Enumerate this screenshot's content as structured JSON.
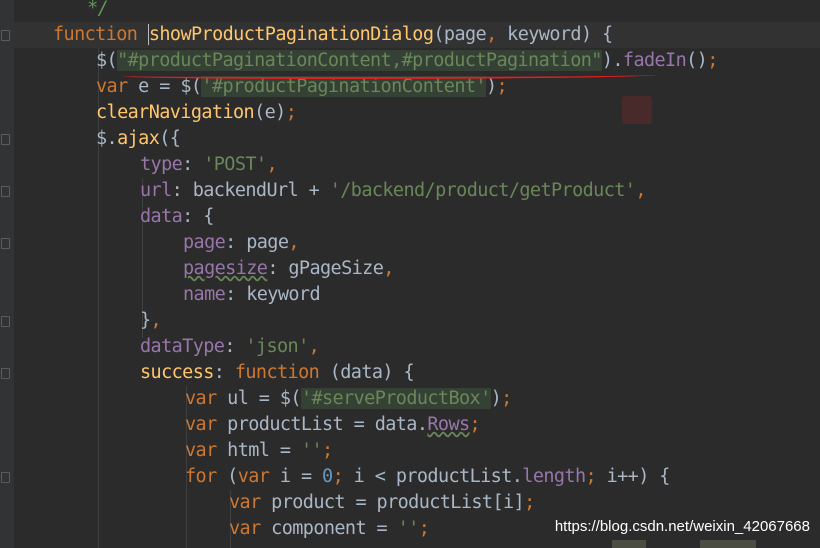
{
  "lines": [
    {
      "tokens": [
        {
          "t": "  */",
          "c": "cm"
        }
      ]
    },
    {
      "tokens": [
        {
          "t": "function",
          "c": "kw"
        },
        {
          "t": " "
        },
        {
          "t": "",
          "c": "caret"
        },
        {
          "t": "showProductPaginationDialog",
          "c": "fn"
        },
        {
          "t": "(page"
        },
        {
          "t": ",",
          "c": "kw"
        },
        {
          "t": " keyword) {"
        }
      ]
    },
    {
      "tokens": [
        {
          "t": "$("
        },
        {
          "t": "\"#productPaginationContent,#productPagination\"",
          "c": "sth"
        },
        {
          "t": ")."
        },
        {
          "t": "fadeIn",
          "c": "pr"
        },
        {
          "t": "()"
        },
        {
          "t": ";",
          "c": "kw"
        }
      ]
    },
    {
      "tokens": [
        {
          "t": "var",
          "c": "kw"
        },
        {
          "t": " e = $("
        },
        {
          "t": "'#productPaginationContent'",
          "c": "sth"
        },
        {
          "t": ")"
        },
        {
          "t": ";",
          "c": "kw"
        }
      ]
    },
    {
      "tokens": [
        {
          "t": "clearNavigation",
          "c": "fn"
        },
        {
          "t": "(e)"
        },
        {
          "t": ";",
          "c": "kw"
        }
      ]
    },
    {
      "tokens": [
        {
          "t": "$."
        },
        {
          "t": "ajax",
          "c": "fn"
        },
        {
          "t": "({"
        }
      ]
    },
    {
      "tokens": [
        {
          "t": "type",
          "c": "pr"
        },
        {
          "t": ": "
        },
        {
          "t": "'POST'",
          "c": "st"
        },
        {
          "t": ",",
          "c": "kw"
        }
      ]
    },
    {
      "tokens": [
        {
          "t": "url",
          "c": "pr"
        },
        {
          "t": ": backendUrl + "
        },
        {
          "t": "'/backend/product/getProduct'",
          "c": "st"
        },
        {
          "t": ",",
          "c": "kw"
        }
      ]
    },
    {
      "tokens": [
        {
          "t": "data",
          "c": "pr"
        },
        {
          "t": ": {"
        }
      ]
    },
    {
      "tokens": [
        {
          "t": "page",
          "c": "pr"
        },
        {
          "t": ": page"
        },
        {
          "t": ",",
          "c": "kw"
        }
      ]
    },
    {
      "tokens": [
        {
          "t": "pagesize",
          "c": "pr wavy"
        },
        {
          "t": ": gPageSize"
        },
        {
          "t": ",",
          "c": "kw"
        }
      ]
    },
    {
      "tokens": [
        {
          "t": "name",
          "c": "pr"
        },
        {
          "t": ": keyword"
        }
      ]
    },
    {
      "tokens": [
        {
          "t": "}"
        },
        {
          "t": ",",
          "c": "kw"
        }
      ]
    },
    {
      "tokens": [
        {
          "t": "dataType",
          "c": "pr"
        },
        {
          "t": ": "
        },
        {
          "t": "'json'",
          "c": "st"
        },
        {
          "t": ",",
          "c": "kw"
        }
      ]
    },
    {
      "tokens": [
        {
          "t": "success",
          "c": "fn"
        },
        {
          "t": ": "
        },
        {
          "t": "function",
          "c": "kw"
        },
        {
          "t": " (data) {"
        }
      ]
    },
    {
      "tokens": [
        {
          "t": "var",
          "c": "kw"
        },
        {
          "t": " ul = $("
        },
        {
          "t": "'#serveProductBox'",
          "c": "sth"
        },
        {
          "t": ")"
        },
        {
          "t": ";",
          "c": "kw"
        }
      ]
    },
    {
      "tokens": [
        {
          "t": "var",
          "c": "kw"
        },
        {
          "t": " productList = data."
        },
        {
          "t": "Rows",
          "c": "pr wavy"
        },
        {
          "t": ";",
          "c": "kw"
        }
      ]
    },
    {
      "tokens": [
        {
          "t": "var",
          "c": "kw"
        },
        {
          "t": " html = "
        },
        {
          "t": "''",
          "c": "st"
        },
        {
          "t": ";",
          "c": "kw"
        }
      ]
    },
    {
      "tokens": [
        {
          "t": "for",
          "c": "kw"
        },
        {
          "t": " ("
        },
        {
          "t": "var",
          "c": "kw"
        },
        {
          "t": " i = "
        },
        {
          "t": "0",
          "c": "nm"
        },
        {
          "t": ";",
          "c": "kw"
        },
        {
          "t": " i < productList."
        },
        {
          "t": "length",
          "c": "pr"
        },
        {
          "t": ";",
          "c": "kw"
        },
        {
          "t": " i++) {"
        }
      ]
    },
    {
      "tokens": [
        {
          "t": "var",
          "c": "kw"
        },
        {
          "t": " product = productList[i]"
        },
        {
          "t": ";",
          "c": "kw"
        }
      ]
    },
    {
      "tokens": [
        {
          "t": "var",
          "c": "kw"
        },
        {
          "t": " component = "
        },
        {
          "t": "''",
          "c": "st"
        },
        {
          "t": ";",
          "c": "kw"
        }
      ]
    }
  ],
  "watermark": "https://blog.csdn.net/weixin_42067668"
}
